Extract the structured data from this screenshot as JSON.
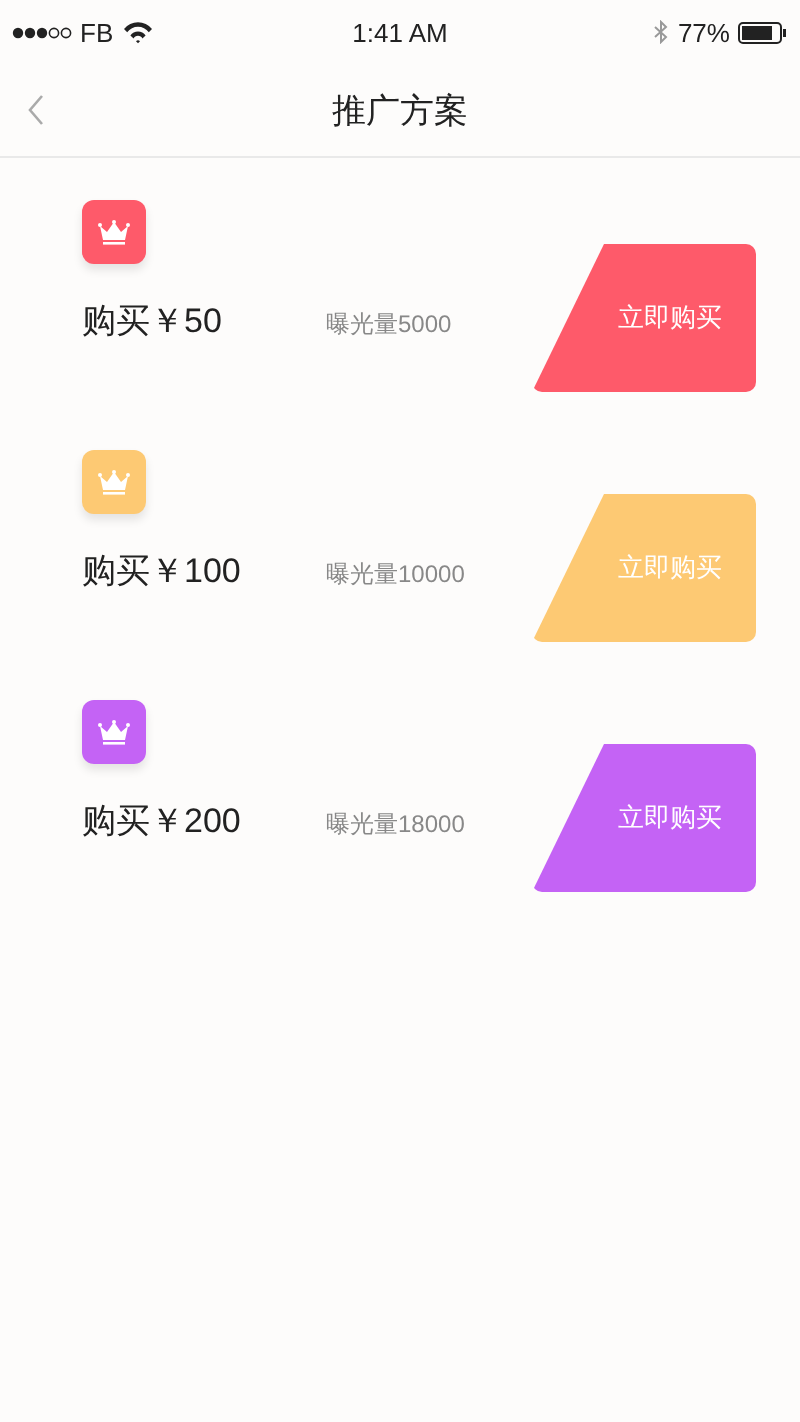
{
  "status_bar": {
    "carrier": "FB",
    "time": "1:41 AM",
    "battery": "77%"
  },
  "nav": {
    "title": "推广方案"
  },
  "plans": [
    {
      "title": "购买￥50",
      "exposure": "曝光量5000",
      "button": "立即购买",
      "color": "#fe5a6a"
    },
    {
      "title": "购买￥100",
      "exposure": "曝光量10000",
      "button": "立即购买",
      "color": "#fdc973"
    },
    {
      "title": "购买￥200",
      "exposure": "曝光量18000",
      "button": "立即购买",
      "color": "#c463f5"
    }
  ]
}
